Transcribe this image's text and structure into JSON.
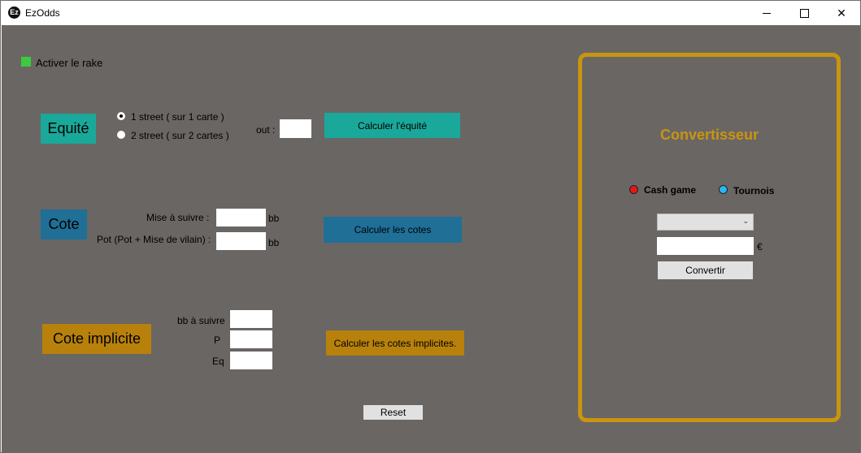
{
  "window": {
    "title": "EzOdds",
    "logo_text": "Ez",
    "minimize_glyph": "",
    "maximize_glyph": "",
    "close_glyph": "✕"
  },
  "rake": {
    "label": "Activer le rake",
    "checked": true
  },
  "equite": {
    "section_label": "Equité",
    "options": [
      "1 street ( sur 1 carte )",
      "2 street ( sur 2 cartes )"
    ],
    "selected_option": 0,
    "out_label": "out :",
    "out_value": "",
    "button_label": "Calculer l'équité"
  },
  "cote": {
    "section_label": "Cote",
    "mise_label": "Mise à suivre :",
    "mise_value": "",
    "mise_unit": "bb",
    "pot_label": "Pot (Pot + Mise de vilain) :",
    "pot_value": "",
    "pot_unit": "bb",
    "button_label": "Calculer les cotes"
  },
  "cote_implicite": {
    "section_label": "Cote implicite",
    "bb_label": "bb à suivre",
    "p_label": "P",
    "eq_label": "Eq",
    "bb_value": "",
    "p_value": "",
    "eq_value": "",
    "button_label": "Calculer les cotes implicites."
  },
  "reset_label": "Reset",
  "convertisseur": {
    "title": "Convertisseur",
    "cash_label": "Cash game",
    "tournois_label": "Tournois",
    "select_value": "",
    "amount_value": "",
    "currency": "€",
    "button_label": "Convertir"
  },
  "colors": {
    "background": "#6a6664",
    "teal": "#1aa89a",
    "blue": "#1f6f97",
    "gold": "#c99510",
    "green": "#3ccb3c",
    "red": "#e21818",
    "cyan": "#2ab6f0"
  }
}
